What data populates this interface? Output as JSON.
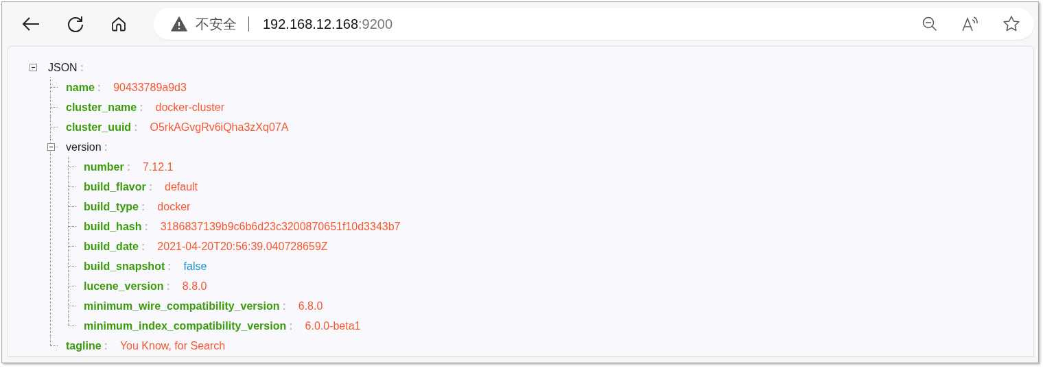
{
  "browser": {
    "security_label": "不安全",
    "url_host": "192.168.12.168",
    "url_port": ":9200"
  },
  "tree": {
    "key": "JSON",
    "colon": ":",
    "kind": "object",
    "expanded": true,
    "children": [
      {
        "key": "name",
        "colon": ":",
        "kind": "string",
        "value": "90433789a9d3"
      },
      {
        "key": "cluster_name",
        "colon": ":",
        "kind": "string",
        "value": "docker-cluster"
      },
      {
        "key": "cluster_uuid",
        "colon": ":",
        "kind": "string",
        "value": "O5rkAGvgRv6iQha3zXq07A"
      },
      {
        "key": "version",
        "colon": ":",
        "kind": "object",
        "expanded": true,
        "children": [
          {
            "key": "number",
            "colon": ":",
            "kind": "string",
            "value": "7.12.1"
          },
          {
            "key": "build_flavor",
            "colon": ":",
            "kind": "string",
            "value": "default"
          },
          {
            "key": "build_type",
            "colon": ":",
            "kind": "string",
            "value": "docker"
          },
          {
            "key": "build_hash",
            "colon": ":",
            "kind": "string",
            "value": "3186837139b9c6b6d23c3200870651f10d3343b7"
          },
          {
            "key": "build_date",
            "colon": ":",
            "kind": "string",
            "value": "2021-04-20T20:56:39.040728659Z"
          },
          {
            "key": "build_snapshot",
            "colon": ":",
            "kind": "boolean",
            "value": "false"
          },
          {
            "key": "lucene_version",
            "colon": ":",
            "kind": "string",
            "value": "8.8.0"
          },
          {
            "key": "minimum_wire_compatibility_version",
            "colon": ":",
            "kind": "string",
            "value": "6.8.0"
          },
          {
            "key": "minimum_index_compatibility_version",
            "colon": ":",
            "kind": "string",
            "value": "6.0.0-beta1"
          }
        ]
      },
      {
        "key": "tagline",
        "colon": ":",
        "kind": "string",
        "value": "You Know, for Search"
      }
    ]
  }
}
